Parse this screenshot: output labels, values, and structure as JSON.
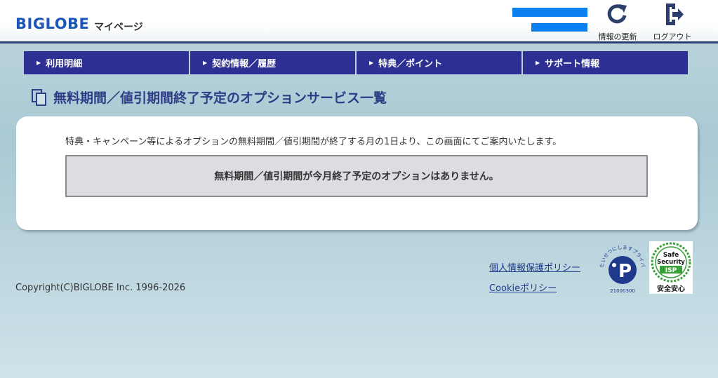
{
  "header": {
    "logo_text": "BIGLOBE",
    "mypage_label": "マイページ",
    "refresh_label": "情報の更新",
    "logout_label": "ログアウト",
    "accent_color": "#0a7ff0"
  },
  "nav": {
    "items": [
      {
        "label": "利用明細"
      },
      {
        "label": "契約情報／履歴"
      },
      {
        "label": "特典／ポイント"
      },
      {
        "label": "サポート情報"
      }
    ],
    "background_color": "#2e2f93"
  },
  "main": {
    "title": "無料期間／値引期間終了予定のオプションサービス一覧",
    "intro": "特典・キャンペーン等によるオプションの無料期間／値引期間が終了する月の1日より、この画面にてご案内いたします。",
    "notice": "無料期間／値引期間が今月終了予定のオプションはありません。"
  },
  "footer": {
    "copyright": "Copyright(C)BIGLOBE Inc. 1996-2026",
    "privacy_link": "個人情報保護ポリシー",
    "cookie_link": "Cookieポリシー",
    "pmark_text": "たいせつにしますプライバシー",
    "pmark_number": "21000300",
    "safe_isp_line1": "Safe",
    "safe_isp_line2": "Security",
    "safe_isp_line3": "ISP",
    "safe_isp_caption": "安全安心"
  }
}
